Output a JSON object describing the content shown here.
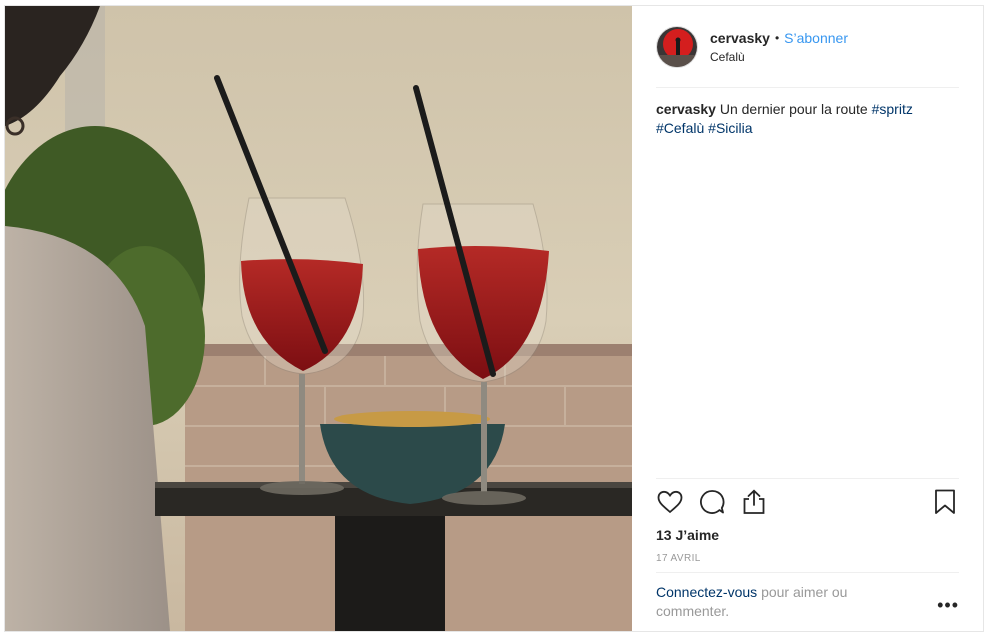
{
  "post": {
    "username": "cervasky",
    "separator": "•",
    "follow_label": "S’abonner",
    "location": "Cefalù",
    "caption": {
      "username": "cervasky",
      "text": "Un dernier pour la route",
      "hashtags": [
        "#spritz",
        "#Cefalù",
        "#Sicilia"
      ]
    },
    "likes": "13 J’aime",
    "date": "17 avril",
    "login": {
      "link": "Connectez-vous",
      "text": "pour aimer ou commenter."
    },
    "more_label": "•••"
  },
  "icons": {
    "like": "heart-icon",
    "comment": "comment-icon",
    "share": "share-icon",
    "save": "bookmark-icon",
    "more": "more-options-icon"
  },
  "colors": {
    "link_blue": "#3897f0",
    "hashtag_blue": "#003569",
    "muted_text": "#999999",
    "border": "#efefef"
  }
}
